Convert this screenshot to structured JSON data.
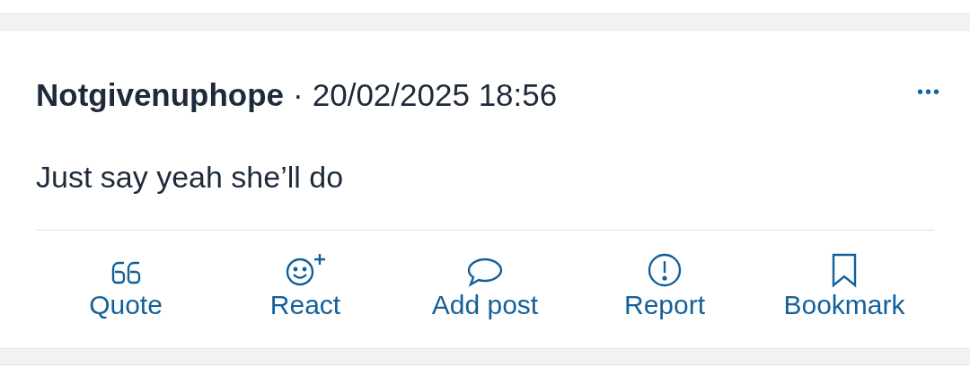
{
  "post": {
    "author": "Notgivenuphope",
    "separator": "·",
    "timestamp": "20/02/2025 18:56",
    "more": "•••",
    "body": "Just say yeah she’ll do",
    "actions": [
      {
        "kind": "quote",
        "label": "Quote"
      },
      {
        "kind": "react",
        "label": "React"
      },
      {
        "kind": "reply",
        "label": "Add post"
      },
      {
        "kind": "report",
        "label": "Report"
      },
      {
        "kind": "bookmark",
        "label": "Bookmark"
      }
    ]
  }
}
